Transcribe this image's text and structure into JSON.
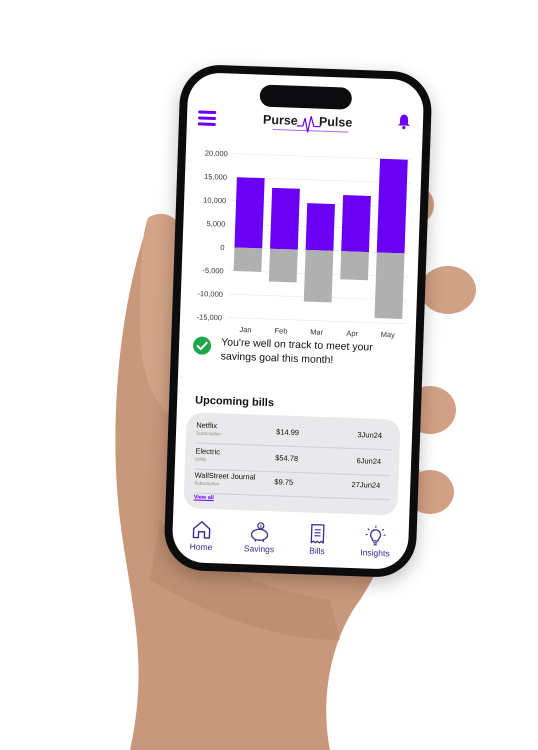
{
  "app": {
    "logo_left": "Purse",
    "logo_right": "Pulse",
    "menu_icon": "hamburger-menu-icon",
    "bell_icon": "bell-icon",
    "accent_color": "#6a00f4",
    "negative_color": "#b0b0b0"
  },
  "chart_data": {
    "type": "bar",
    "categories": [
      "Jan",
      "Feb",
      "Mar",
      "Apr",
      "May"
    ],
    "series": [
      {
        "values": [
          15000,
          13000,
          10000,
          12000,
          20000
        ]
      },
      {
        "values": [
          -5000,
          -7000,
          -11000,
          -6000,
          -14000
        ]
      }
    ],
    "ylim": [
      -15000,
      20000
    ],
    "yticks": [
      "20,000",
      "15,000",
      "10,000",
      "5,000",
      "0",
      "-5,000",
      "-10,000",
      "-15,000"
    ],
    "ytick_values": [
      20000,
      15000,
      10000,
      5000,
      0,
      -5000,
      -10000,
      -15000
    ],
    "grid": true,
    "stacked": true,
    "colors": [
      "#6a00f4",
      "#b0b0b0"
    ]
  },
  "status": {
    "message": "You're well on track to meet your savings goal this month!",
    "icon": "check-circle-icon"
  },
  "bills": {
    "title": "Upcoming bills",
    "items": [
      {
        "name": "Netflix",
        "category": "Subscription",
        "amount": "$14.99",
        "date": "3Jun24"
      },
      {
        "name": "Electric",
        "category": "Utility",
        "amount": "$54.78",
        "date": "6Jun24"
      },
      {
        "name": "WallStreet Journal",
        "category": "Subscription",
        "amount": "$9.75",
        "date": "27Jun24"
      }
    ],
    "view_all": "View all"
  },
  "nav": {
    "items": [
      {
        "label": "Home",
        "icon": "home-icon"
      },
      {
        "label": "Savings",
        "icon": "piggy-bank-icon"
      },
      {
        "label": "Bills",
        "icon": "receipt-icon"
      },
      {
        "label": "Insights",
        "icon": "lightbulb-icon"
      }
    ]
  }
}
